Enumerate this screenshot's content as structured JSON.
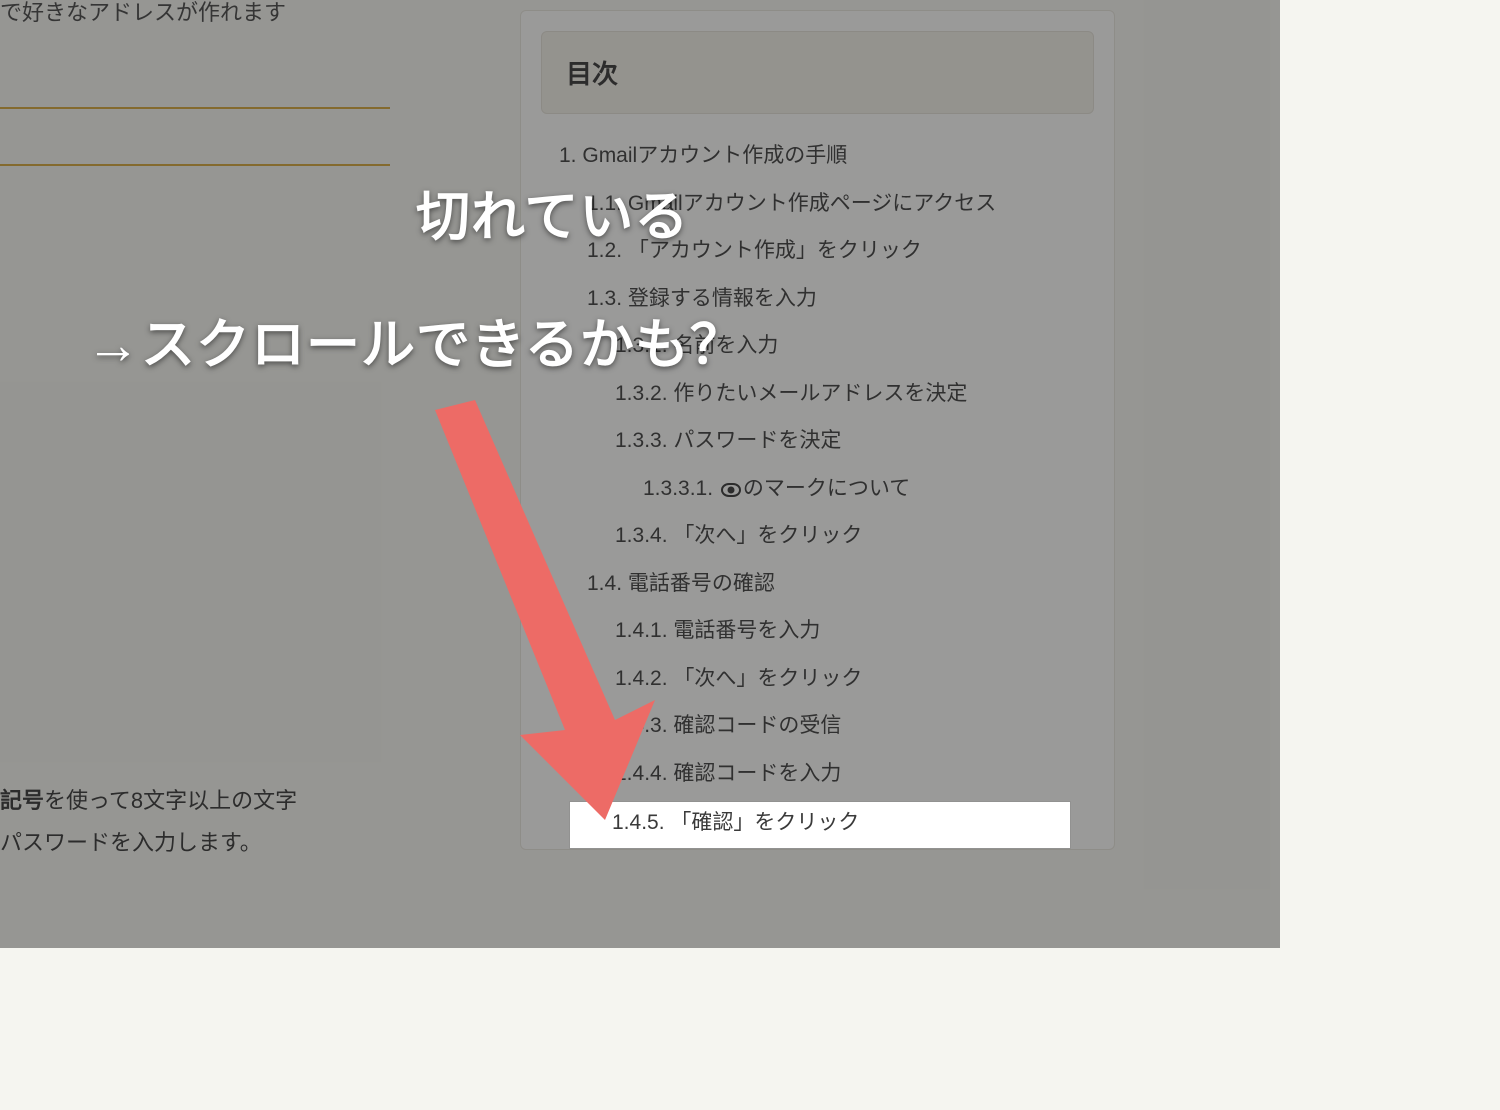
{
  "left": {
    "top_text": "で好きなアドレスが作れます",
    "bottom_line1_prefix": " ",
    "bottom_bold": "記号",
    "bottom_line1_suffix": "を使って8文字以上の文字",
    "bottom_line2": "パスワードを入力します。"
  },
  "toc": {
    "title": "目次",
    "items": [
      {
        "num": "1.",
        "label": "Gmailアカウント作成の手順",
        "level": 1
      },
      {
        "num": "1.1.",
        "label": "Gmailアカウント作成ページにアクセス",
        "level": 2
      },
      {
        "num": "1.2.",
        "label": "「アカウント作成」をクリック",
        "level": 2
      },
      {
        "num": "1.3.",
        "label": "登録する情報を入力",
        "level": 2
      },
      {
        "num": "1.3.1.",
        "label": "名前を入力",
        "level": 3
      },
      {
        "num": "1.3.2.",
        "label": "作りたいメールアドレスを決定",
        "level": 3
      },
      {
        "num": "1.3.3.",
        "label": "パスワードを決定",
        "level": 3
      },
      {
        "num": "1.3.3.1.",
        "label": "のマークについて",
        "level": 4,
        "eye": true
      },
      {
        "num": "1.3.4.",
        "label": "「次へ」をクリック",
        "level": 3
      },
      {
        "num": "1.4.",
        "label": "電話番号の確認",
        "level": 2
      },
      {
        "num": "1.4.1.",
        "label": "電話番号を入力",
        "level": 3
      },
      {
        "num": "1.4.2.",
        "label": "「次へ」をクリック",
        "level": 3
      },
      {
        "num": "1.4.3.",
        "label": "確認コードの受信",
        "level": 3
      },
      {
        "num": "1.4.4.",
        "label": "確認コードを入力",
        "level": 3
      },
      {
        "num": "1.4.5.",
        "label": "「確認」をクリック",
        "level": 3,
        "cut": true
      }
    ]
  },
  "highlight_text": "1.4.5. 「確認」をクリック",
  "annotation": {
    "line1": "切れている",
    "line2": "→スクロールできるかも？"
  }
}
